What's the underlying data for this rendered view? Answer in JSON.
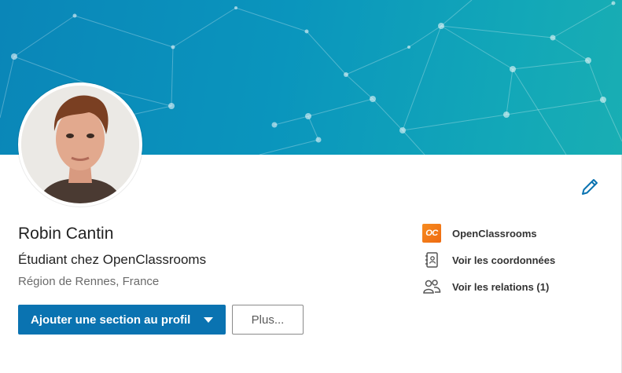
{
  "profile": {
    "name": "Robin Cantin",
    "headline": "Étudiant chez OpenClassrooms",
    "location": "Région de Rennes, France"
  },
  "actions": {
    "add_section_label": "Ajouter une section au profil",
    "more_label": "Plus..."
  },
  "sidebar": {
    "items": [
      {
        "label": "OpenClassrooms",
        "icon": "openclassrooms-logo",
        "logo_text": "OC"
      },
      {
        "label": "Voir les coordonnées",
        "icon": "contact-book-icon"
      },
      {
        "label": "Voir les relations (1)",
        "icon": "people-icon"
      }
    ]
  },
  "colors": {
    "banner_start": "#0a86b8",
    "banner_end": "#19aeb3",
    "primary_button": "#0a73b1",
    "edit_icon": "#0a73b1",
    "openclassrooms_brand": "#f68b1f"
  },
  "icons": {
    "edit": "pencil-icon",
    "dropdown": "caret-down-icon"
  }
}
